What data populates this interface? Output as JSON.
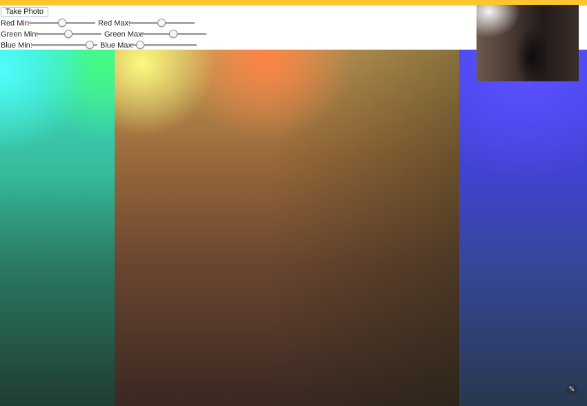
{
  "toolbar": {
    "take_photo_label": "Take Photo"
  },
  "sliders": {
    "red_min": {
      "label": "Red Min:",
      "value": 0.5
    },
    "red_max": {
      "label": "Red Max:",
      "value": 0.5
    },
    "green_min": {
      "label": "Green Min:",
      "value": 0.5
    },
    "green_max": {
      "label": "Green Max:",
      "value": 0.5
    },
    "blue_min": {
      "label": "Blue Min:",
      "value": 0.94
    },
    "blue_max": {
      "label": "Blue Max:",
      "value": 0.1
    }
  },
  "colors": {
    "top_bar": "#FDC530",
    "band_cyan": "#3ee8c8",
    "band_warm": "#c79d55",
    "band_blue": "#4b48f2"
  },
  "icons": {
    "corner": "edit-icon"
  }
}
